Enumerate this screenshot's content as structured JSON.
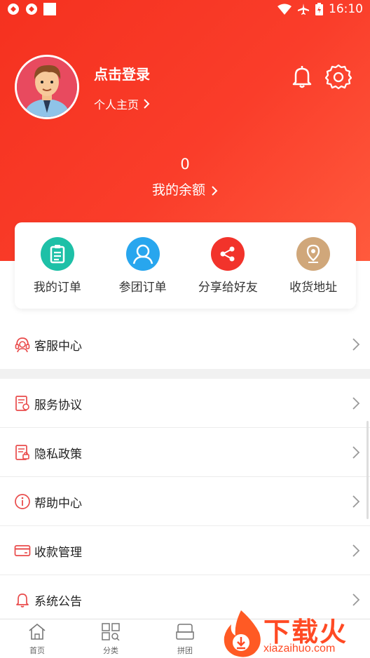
{
  "status_bar": {
    "time": "16:10"
  },
  "profile": {
    "login_text": "点击登录",
    "homepage_link": "个人主页"
  },
  "balance": {
    "value": "0",
    "label": "我的余额"
  },
  "quick_actions": [
    {
      "label": "我的订单",
      "icon": "clipboard-icon",
      "color": "#1ec0a7"
    },
    {
      "label": "参团订单",
      "icon": "group-user-icon",
      "color": "#28a6ee"
    },
    {
      "label": "分享给好友",
      "icon": "share-icon",
      "color": "#f2332b"
    },
    {
      "label": "收货地址",
      "icon": "location-pin-icon",
      "color": "#d0a77a"
    }
  ],
  "menu": [
    {
      "label": "客服中心",
      "icon": "customer-service-icon"
    },
    {
      "label": "服务协议",
      "icon": "agreement-doc-icon"
    },
    {
      "label": "隐私政策",
      "icon": "privacy-doc-icon"
    },
    {
      "label": "帮助中心",
      "icon": "info-circle-icon"
    },
    {
      "label": "收款管理",
      "icon": "card-icon"
    },
    {
      "label": "系统公告",
      "icon": "bell-outline-icon"
    }
  ],
  "tabbar": [
    {
      "label": "首页",
      "icon": "home-icon"
    },
    {
      "label": "分类",
      "icon": "category-grid-icon"
    },
    {
      "label": "拼团",
      "icon": "group-buy-icon"
    }
  ],
  "watermark": {
    "brand": "下载火",
    "domain": "xiazaihuo.com"
  },
  "colors": {
    "primary": "#f5311f",
    "menu_icon": "#e94b4b"
  }
}
